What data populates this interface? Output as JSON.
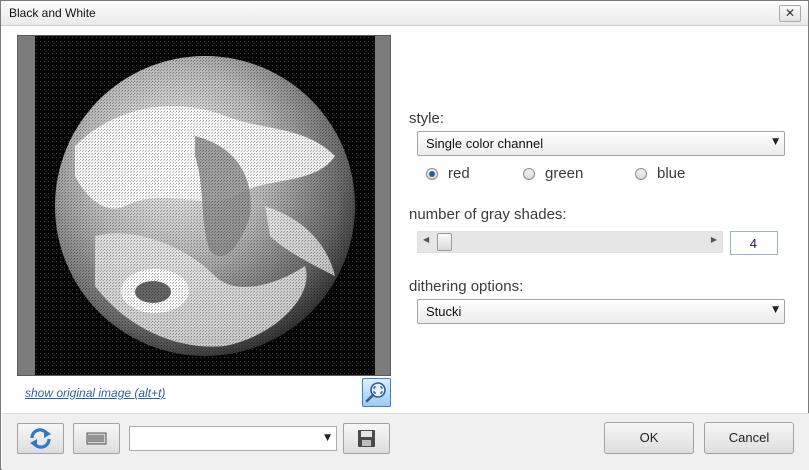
{
  "window": {
    "title": "Black and White",
    "close_glyph": "✕"
  },
  "preview": {
    "show_original_link": "show original image (alt+t)",
    "fit_icon": "zoom-fit-icon"
  },
  "style": {
    "label": "style:",
    "selected": "Single color channel",
    "channels": [
      {
        "label": "red",
        "checked": true
      },
      {
        "label": "green",
        "checked": false
      },
      {
        "label": "blue",
        "checked": false
      }
    ]
  },
  "gray_shades": {
    "label": "number of gray shades:",
    "value": "4"
  },
  "dithering": {
    "label": "dithering options:",
    "selected": "Stucki"
  },
  "footer": {
    "refresh_icon": "refresh-icon",
    "randomize_icon": "keyboard-icon",
    "preset_value": "",
    "save_icon": "save-preset-icon",
    "ok_label": "OK",
    "cancel_label": "Cancel"
  },
  "colors": {
    "link": "#2f5fa8",
    "accent": "#3e7fc4",
    "radio_selected": "#2c5f98"
  }
}
